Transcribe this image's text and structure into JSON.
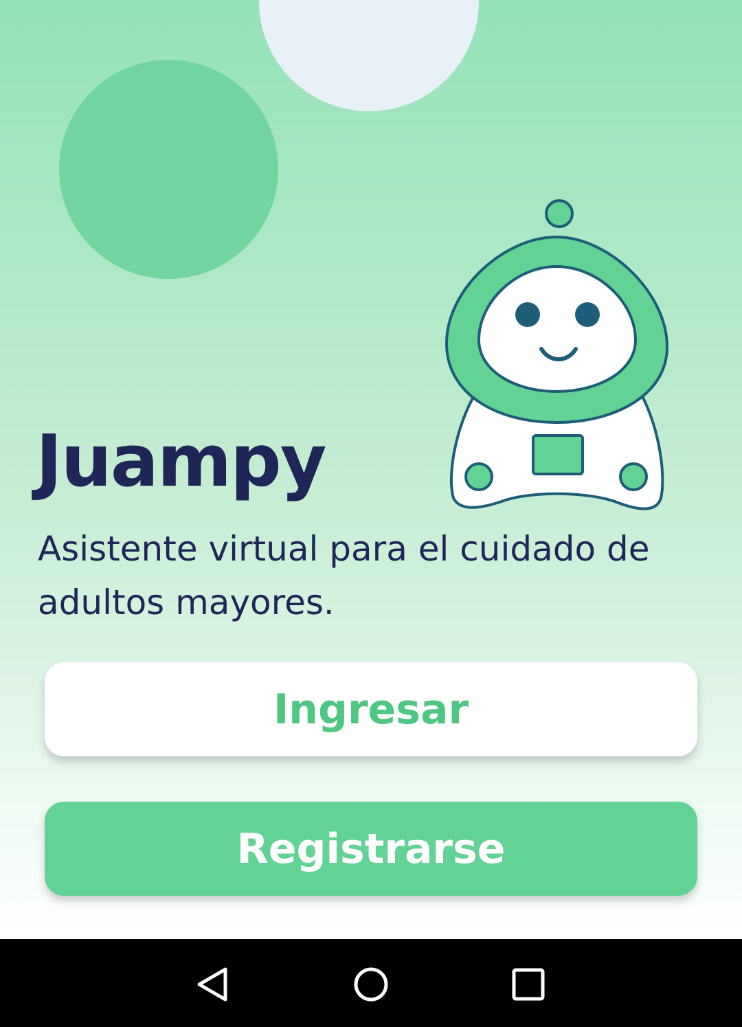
{
  "app": {
    "title": "Juampy",
    "subtitle": "Asistente virtual para el cuidado de adultos mayores."
  },
  "actions": {
    "login_label": "Ingresar",
    "register_label": "Registrarse"
  },
  "navbar": {
    "back_icon": "back-triangle-icon",
    "home_icon": "home-circle-icon",
    "recents_icon": "recents-square-icon"
  },
  "colors": {
    "primary_green": "#62d295",
    "dark_navy": "#1e2657",
    "robot_outline": "#1d5d78",
    "background_top": "#95e2b7"
  }
}
